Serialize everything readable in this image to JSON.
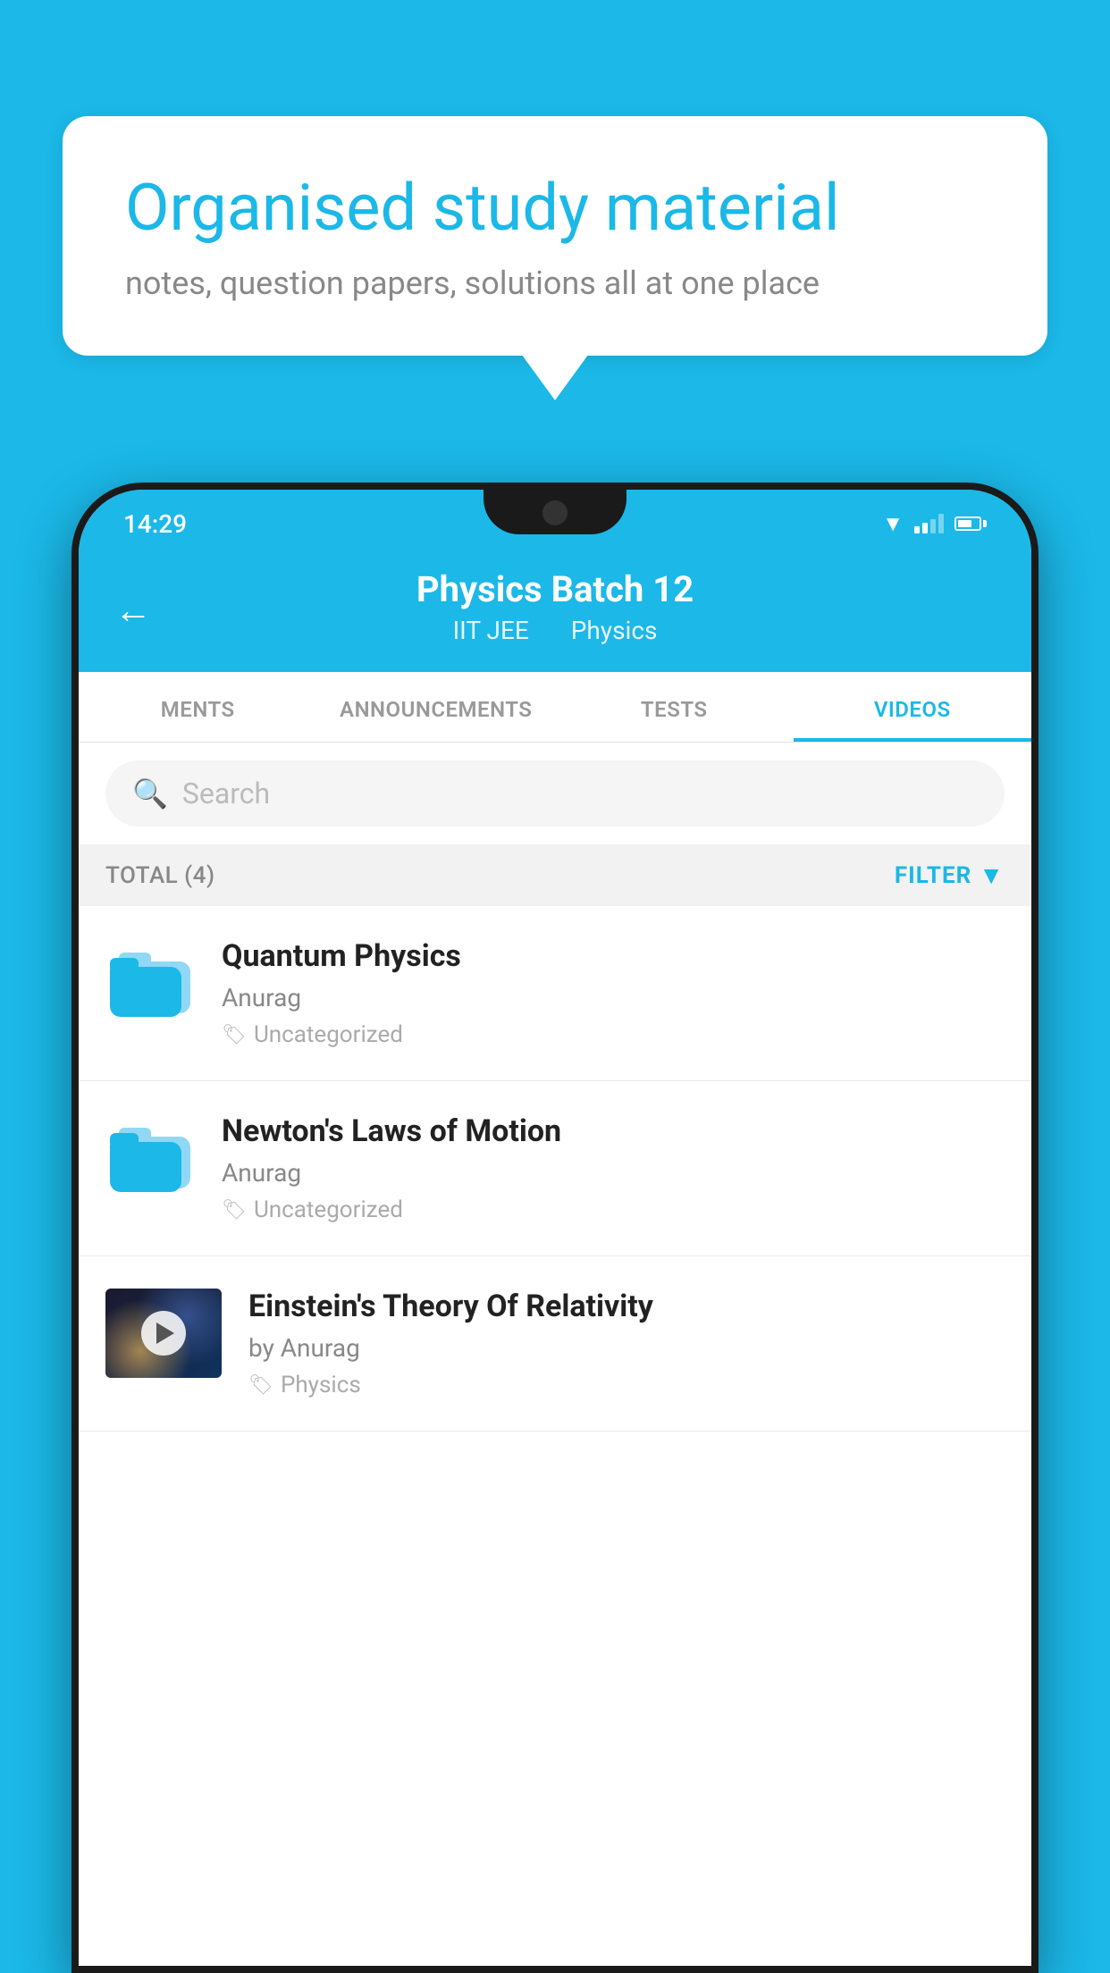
{
  "promo": {
    "title": "Organised study material",
    "subtitle": "notes, question papers, solutions all at one place"
  },
  "statusBar": {
    "time": "14:29",
    "wifiIcon": "wifi",
    "signalIcon": "signal",
    "batteryIcon": "battery"
  },
  "header": {
    "backLabel": "←",
    "title": "Physics Batch 12",
    "tag1": "IIT JEE",
    "tag2": "Physics"
  },
  "tabs": [
    {
      "label": "MENTS",
      "active": false
    },
    {
      "label": "ANNOUNCEMENTS",
      "active": false
    },
    {
      "label": "TESTS",
      "active": false
    },
    {
      "label": "VIDEOS",
      "active": true
    }
  ],
  "search": {
    "placeholder": "Search"
  },
  "filterBar": {
    "totalLabel": "TOTAL (4)",
    "filterLabel": "FILTER"
  },
  "videos": [
    {
      "id": 1,
      "title": "Quantum Physics",
      "author": "Anurag",
      "tag": "Uncategorized",
      "hasThumb": false
    },
    {
      "id": 2,
      "title": "Newton's Laws of Motion",
      "author": "Anurag",
      "tag": "Uncategorized",
      "hasThumb": false
    },
    {
      "id": 3,
      "title": "Einstein's Theory Of Relativity",
      "author": "by Anurag",
      "tag": "Physics",
      "hasThumb": true
    }
  ]
}
